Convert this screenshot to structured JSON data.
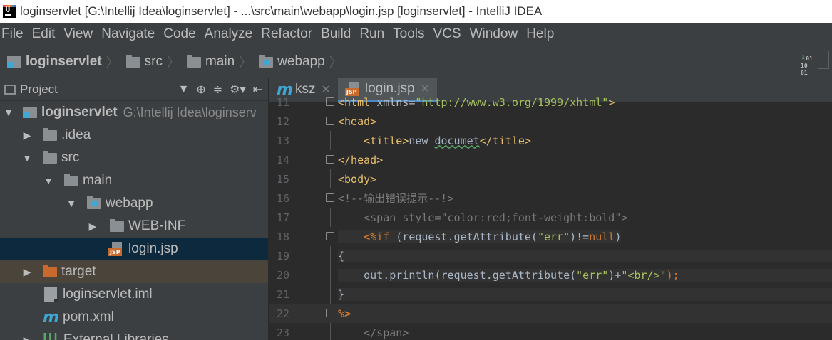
{
  "window": {
    "title": "loginservlet [G:\\Intellij Idea\\loginservlet] - ...\\src\\main\\webapp\\login.jsp [loginservlet] - IntelliJ IDEA",
    "icon": "intellij-icon"
  },
  "menu": [
    "File",
    "Edit",
    "View",
    "Navigate",
    "Code",
    "Analyze",
    "Refactor",
    "Build",
    "Run",
    "Tools",
    "VCS",
    "Window",
    "Help"
  ],
  "breadcrumb": [
    "loginservlet",
    "src",
    "main",
    "webapp"
  ],
  "project_panel": {
    "title": "Project",
    "tree": [
      {
        "label": "loginservlet",
        "path": "G:\\Intellij Idea\\loginserv",
        "arrow": "▼",
        "icon": "project-folder-icon"
      },
      {
        "label": ".idea",
        "arrow": "▶",
        "icon": "folder-icon"
      },
      {
        "label": "src",
        "arrow": "▼",
        "icon": "folder-icon"
      },
      {
        "label": "main",
        "arrow": "▼",
        "icon": "folder-icon"
      },
      {
        "label": "webapp",
        "arrow": "▼",
        "icon": "web-folder-icon"
      },
      {
        "label": "WEB-INF",
        "arrow": "▶",
        "icon": "folder-icon"
      },
      {
        "label": "login.jsp",
        "arrow": "",
        "icon": "jsp-file-icon"
      },
      {
        "label": "target",
        "arrow": "▶",
        "icon": "excluded-folder-icon"
      },
      {
        "label": "loginservlet.iml",
        "arrow": "",
        "icon": "iml-file-icon"
      },
      {
        "label": "pom.xml",
        "arrow": "",
        "icon": "maven-icon"
      },
      {
        "label": "External Libraries",
        "arrow": "▶",
        "icon": "libraries-icon"
      }
    ]
  },
  "tabs": [
    {
      "label": "ksz",
      "icon": "maven-icon",
      "active": false
    },
    {
      "label": "login.jsp",
      "icon": "jsp-file-icon",
      "active": true
    }
  ],
  "code": {
    "line_numbers": [
      "11",
      "12",
      "13",
      "14",
      "15",
      "16",
      "17",
      "18",
      "19",
      "20",
      "21",
      "22",
      "23"
    ],
    "l11": {
      "tag1": "<html ",
      "attr": "xmlns=",
      "str": "\"http://www.w3.org/1999/xhtml\"",
      "tag2": ">"
    },
    "l12": "<head>",
    "l13": {
      "indent": "    ",
      "open": "<title>",
      "text": "new ",
      "wave": "documet",
      "close": "</title>"
    },
    "l14": "</head>",
    "l15": "<body>",
    "l16": "<!--输出错误提示--!>",
    "l17": {
      "indent": "    ",
      "tag": "<span ",
      "attr": "style=",
      "str": "\"color:red;font-weight:bold\"",
      "end": ">"
    },
    "l18": {
      "indent": "    ",
      "jsp": "<%",
      "kw": "if",
      "t1": " (request.getAttribute(",
      "str": "\"err\"",
      "t2": ")!=",
      "nul": "null",
      "t3": ")"
    },
    "l19": "{",
    "l20": {
      "indent": "    ",
      "t1": "out.println(request.getAttribute(",
      "s1": "\"err\"",
      "t2": ")+",
      "s2": "\"<br/>\"",
      "t3": ");"
    },
    "l21": "}",
    "l22": "%>",
    "l23": {
      "indent": "    ",
      "tag": "</span>"
    }
  }
}
